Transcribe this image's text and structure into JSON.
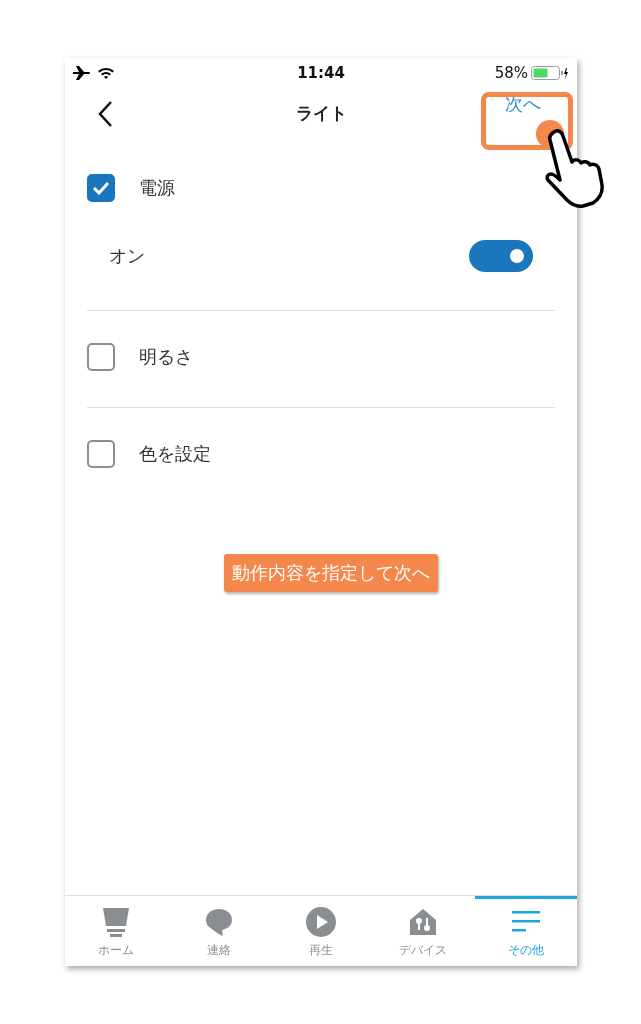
{
  "status_bar": {
    "time": "11:44",
    "battery": "58%"
  },
  "nav": {
    "title": "ライト",
    "next": "次へ"
  },
  "items": [
    {
      "kind": "checkbox",
      "label": "電源",
      "checked": true
    },
    {
      "kind": "toggle",
      "label": "オン",
      "on": true
    },
    {
      "kind": "checkbox",
      "label": "明るさ",
      "checked": false
    },
    {
      "kind": "checkbox",
      "label": "色を設定",
      "checked": false
    }
  ],
  "callout": "動作内容を指定して次へ",
  "tabs": [
    {
      "kind": "home",
      "label": "ホーム",
      "selected": false
    },
    {
      "kind": "chat",
      "label": "連絡",
      "selected": false
    },
    {
      "kind": "play",
      "label": "再生",
      "selected": false
    },
    {
      "kind": "device",
      "label": "デバイス",
      "selected": false
    },
    {
      "kind": "more",
      "label": "その他",
      "selected": true
    }
  ]
}
